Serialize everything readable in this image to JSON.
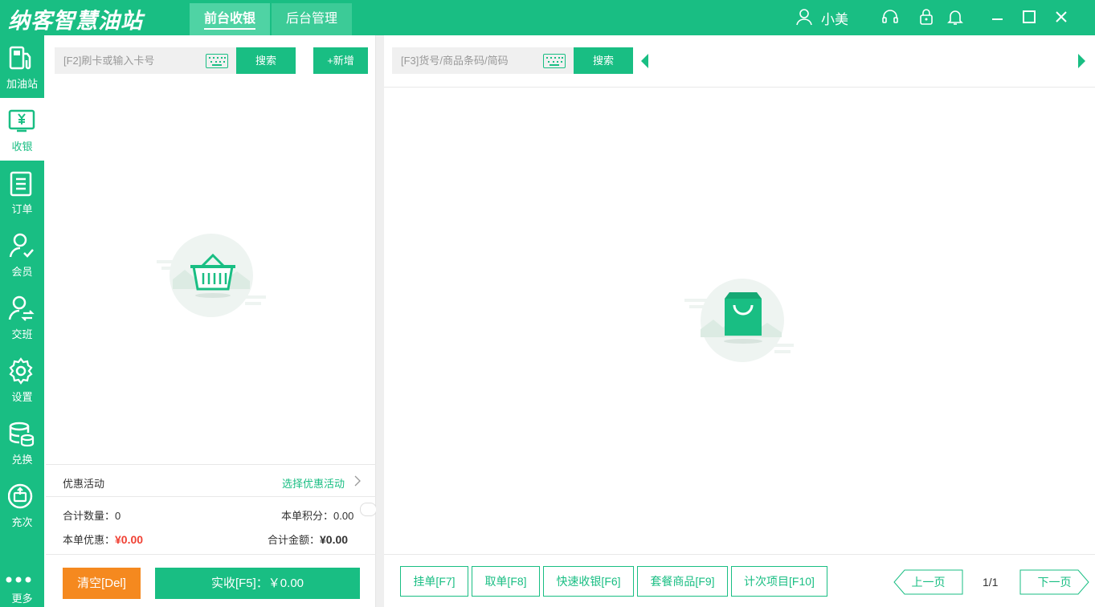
{
  "app": {
    "logo": "纳客智慧油站"
  },
  "tabs": [
    {
      "label": "前台收银",
      "active": true
    },
    {
      "label": "后台管理",
      "active": false
    }
  ],
  "titlebar": {
    "user": "小美"
  },
  "sidebar": {
    "items": [
      {
        "label": "加油站",
        "icon": "fuel-pump-icon"
      },
      {
        "label": "收银",
        "icon": "cashier-monitor-icon",
        "active": true
      },
      {
        "label": "订单",
        "icon": "order-list-icon"
      },
      {
        "label": "会员",
        "icon": "member-icon"
      },
      {
        "label": "交班",
        "icon": "shift-handover-icon"
      },
      {
        "label": "设置",
        "icon": "gear-icon"
      },
      {
        "label": "兑换",
        "icon": "database-icon"
      },
      {
        "label": "充次",
        "icon": "recharge-icon"
      },
      {
        "label": "更多",
        "icon": "more-dots-icon"
      }
    ]
  },
  "left": {
    "card_search_placeholder": "[F2]刷卡或输入卡号",
    "search_label": "搜索",
    "add_label": "+新增",
    "promo_label": "优惠活动",
    "promo_select": "选择优惠活动",
    "total_qty_label": "合计数量：",
    "total_qty": "0",
    "points_label": "本单积分：",
    "points": "0.00",
    "discount_label": "本单优惠：",
    "discount": "¥0.00",
    "total_amount_label": "合计金额：",
    "total_amount": "¥0.00",
    "clear_label": "清空[Del]",
    "pay_label": "实收[F5]：￥0.00"
  },
  "right": {
    "product_search_placeholder": "[F3]货号/商品条码/简码",
    "search_label": "搜索",
    "buttons": [
      "挂单[F7]",
      "取单[F8]",
      "快速收银[F6]",
      "套餐商品[F9]",
      "计次项目[F10]"
    ],
    "prev_page": "上一页",
    "page_indicator": "1/1",
    "next_page": "下一页"
  },
  "colors": {
    "accent": "#19be83",
    "orange": "#f5891f",
    "red": "#f04134"
  }
}
